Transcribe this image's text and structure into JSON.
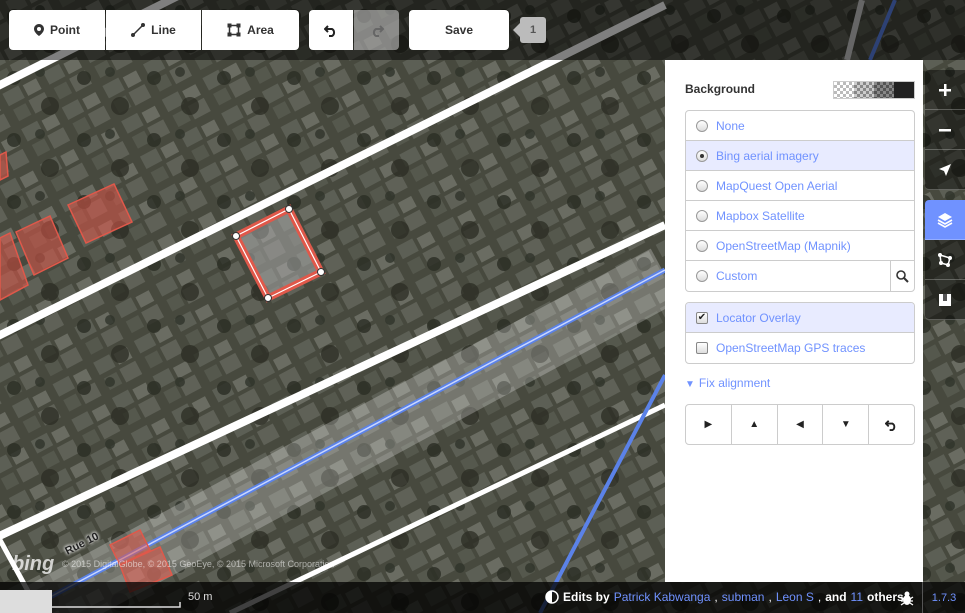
{
  "toolbar": {
    "point_label": "Point",
    "line_label": "Line",
    "area_label": "Area",
    "save_label": "Save",
    "save_count": "1"
  },
  "background_panel": {
    "title": "Background",
    "sources": [
      {
        "label": "None",
        "selected": false
      },
      {
        "label": "Bing aerial imagery",
        "selected": true
      },
      {
        "label": "MapQuest Open Aerial",
        "selected": false
      },
      {
        "label": "Mapbox Satellite",
        "selected": false
      },
      {
        "label": "OpenStreetMap (Mapnik)",
        "selected": false
      },
      {
        "label": "Custom",
        "selected": false
      }
    ],
    "overlays": [
      {
        "label": "Locator Overlay",
        "checked": true
      },
      {
        "label": "OpenStreetMap GPS traces",
        "checked": false
      }
    ],
    "fix_alignment_label": "Fix alignment"
  },
  "map": {
    "street_label": "Rue 10",
    "bing_logo": "bing",
    "copyright": "© 2015 DigitalGlobe, © 2015 GeoEye, © 2015 Microsoft Corporation"
  },
  "footer": {
    "scale_label": "50 m",
    "edits_by": "Edits by",
    "users": [
      "Patrick Kabwanga",
      "subman",
      "Leon S"
    ],
    "and_text": "and",
    "others_count": "11",
    "others_text": "others",
    "version": "1.7.3"
  },
  "colors": {
    "accent": "#7092ff",
    "selected_area": "#e0584a",
    "road": "#ffffff",
    "path_blue": "#5b82e8"
  }
}
